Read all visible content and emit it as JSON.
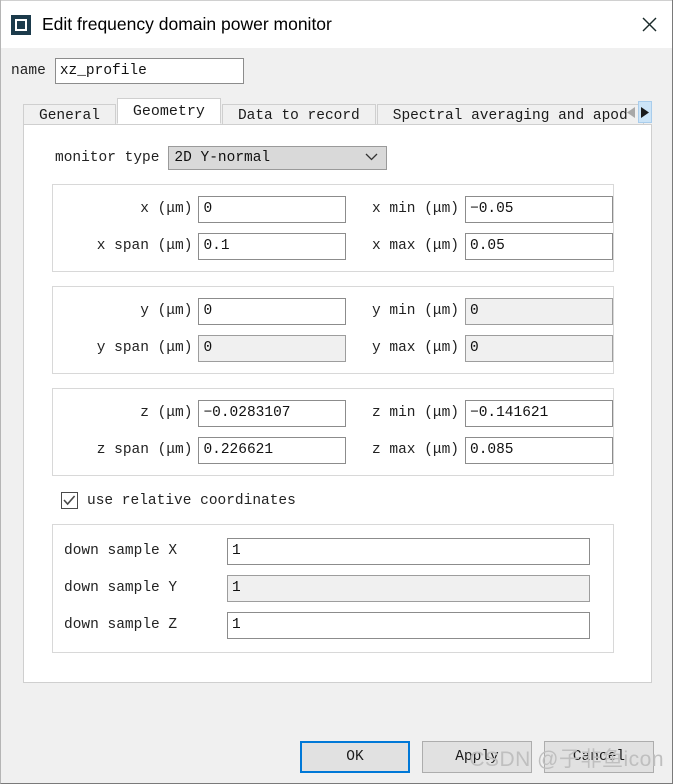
{
  "window": {
    "title": "Edit frequency domain power monitor",
    "icon": "monitor-icon",
    "close_label": "✕"
  },
  "name_field": {
    "label": "name",
    "value": "xz_profile"
  },
  "tabs": {
    "items": [
      {
        "label": "General",
        "active": false
      },
      {
        "label": "Geometry",
        "active": true
      },
      {
        "label": "Data to record",
        "active": false
      },
      {
        "label": "Spectral averaging and apod",
        "active": false
      }
    ],
    "scroll_left": "◀",
    "scroll_right": "▶"
  },
  "geometry": {
    "monitor_type": {
      "label": "monitor type",
      "value": "2D Y-normal",
      "chevron": "chevron-down-icon"
    },
    "x_group": {
      "pos_label": "x (μm)",
      "pos_value": "0",
      "min_label": "x min (μm)",
      "min_value": "−0.05",
      "span_label": "x span (μm)",
      "span_value": "0.1",
      "max_label": "x max (μm)",
      "max_value": "0.05"
    },
    "y_group": {
      "pos_label": "y (μm)",
      "pos_value": "0",
      "min_label": "y min (μm)",
      "min_value": "0",
      "span_label": "y span (μm)",
      "span_value": "0",
      "max_label": "y max (μm)",
      "max_value": "0"
    },
    "z_group": {
      "pos_label": "z (μm)",
      "pos_value": "−0.0283107",
      "min_label": "z min (μm)",
      "min_value": "−0.141621",
      "span_label": "z span (μm)",
      "span_value": "0.226621",
      "max_label": "z max (μm)",
      "max_value": "0.085"
    },
    "relative_coords": {
      "label": "use relative coordinates",
      "checked": true
    },
    "down_sample": {
      "x_label": "down sample X",
      "x_value": "1",
      "y_label": "down sample Y",
      "y_value": "1",
      "z_label": "down sample Z",
      "z_value": "1"
    }
  },
  "footer": {
    "ok": "OK",
    "apply": "Apply",
    "cancel": "Cancel"
  },
  "watermark": "CSDN @子非鱼icon"
}
